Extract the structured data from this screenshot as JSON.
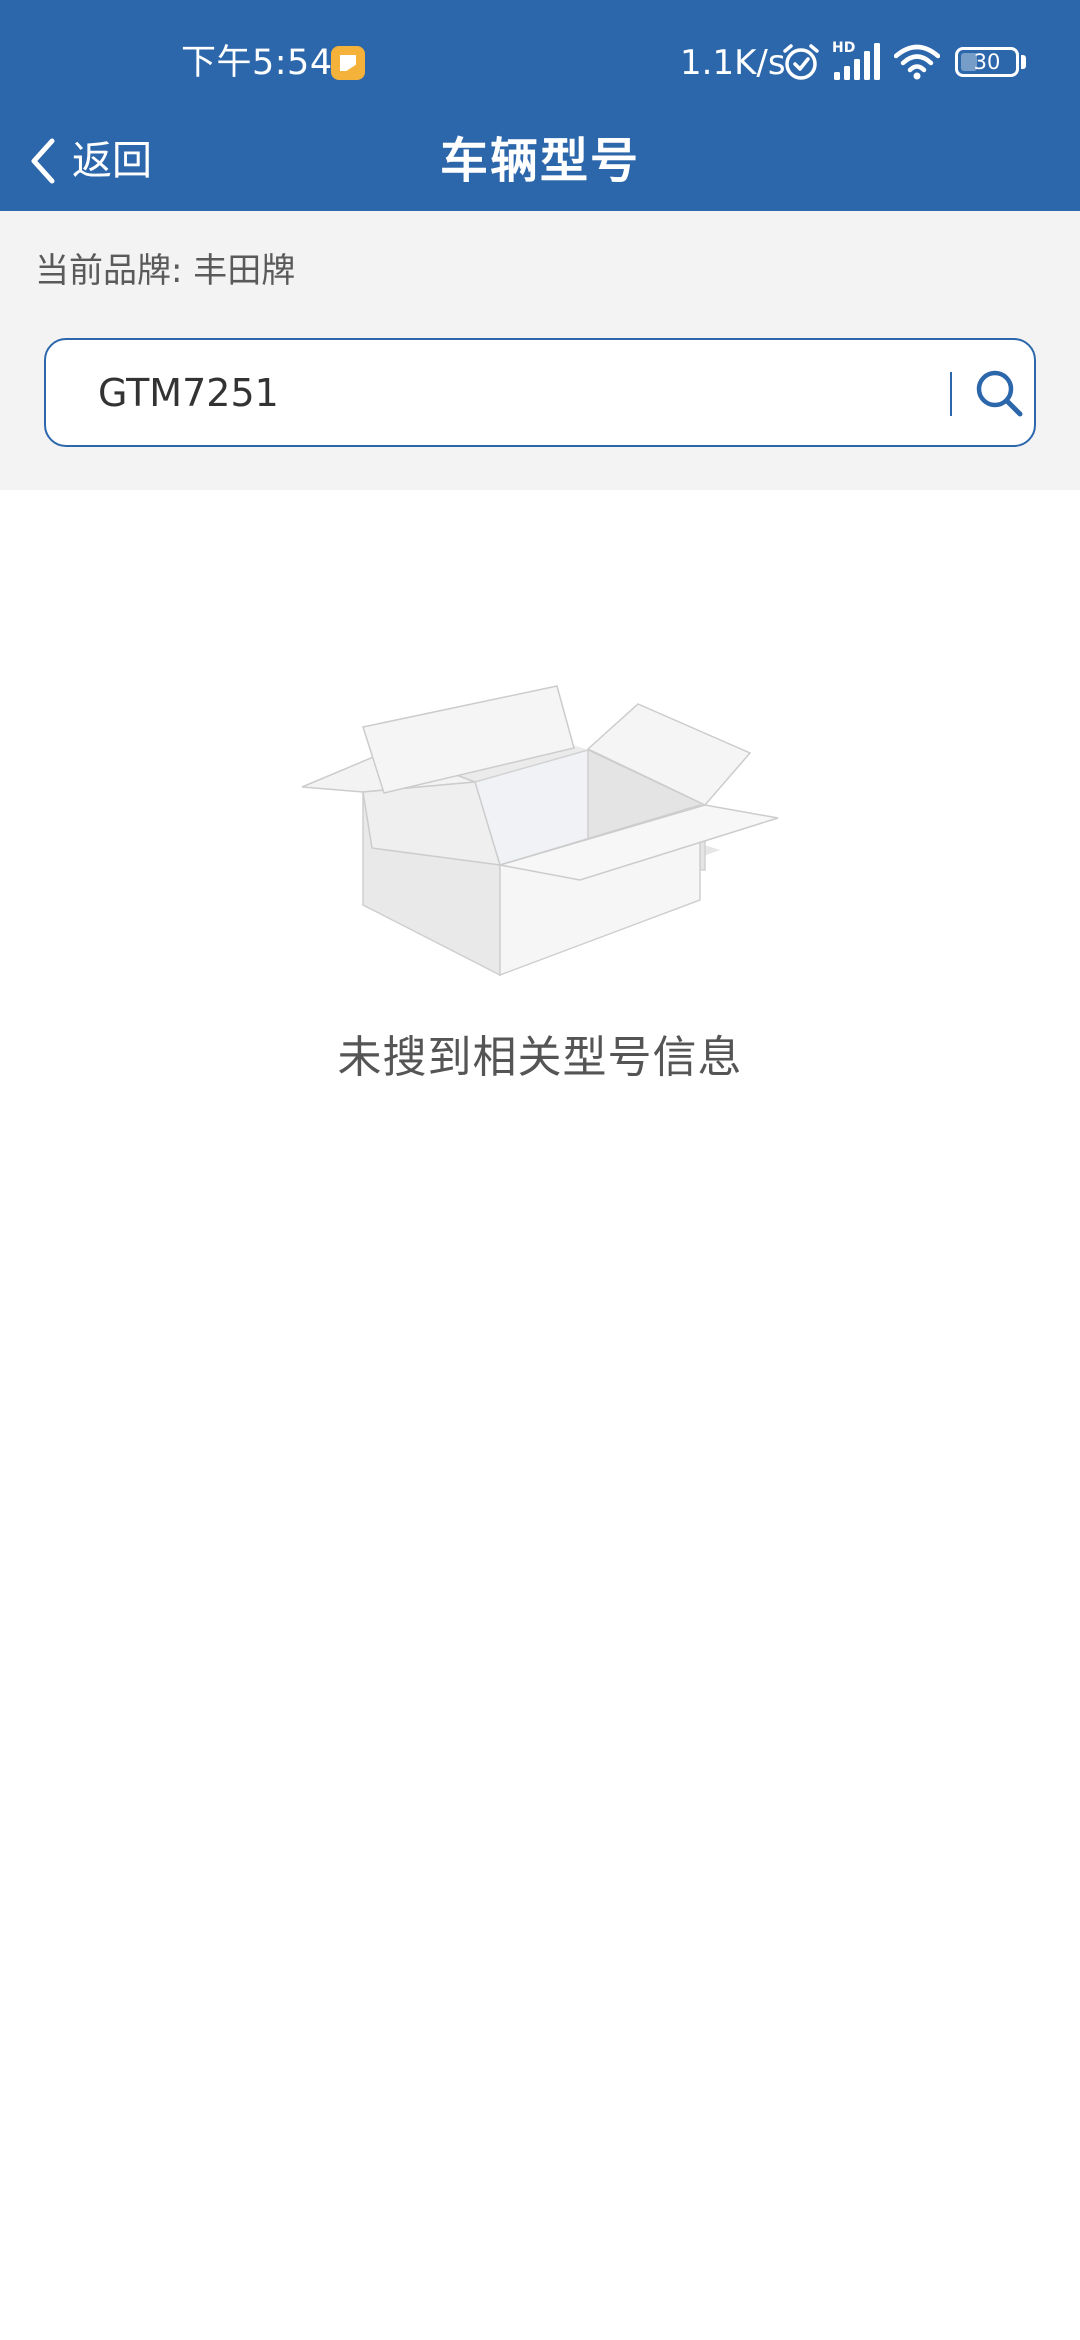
{
  "status_bar": {
    "time": "下午5:54",
    "network_speed": "1.1K/s",
    "signal_badge": "HD",
    "battery_level": "30"
  },
  "nav": {
    "back_label": "返回",
    "title": "车辆型号"
  },
  "brand": {
    "current_brand_line": "当前品牌: 丰田牌"
  },
  "search": {
    "value": "GTM7251"
  },
  "empty_state": {
    "message": "未搜到相关型号信息"
  },
  "colors": {
    "primary": "#2d67ab",
    "panel_background": "#f3f3f3",
    "notification_badge": "#f4b23b"
  },
  "icons": {
    "back": "chevron-left-icon",
    "search": "search-icon",
    "alarm": "alarm-icon",
    "signal": "signal-icon",
    "wifi": "wifi-icon",
    "battery": "battery-icon",
    "empty": "empty-box-icon"
  }
}
